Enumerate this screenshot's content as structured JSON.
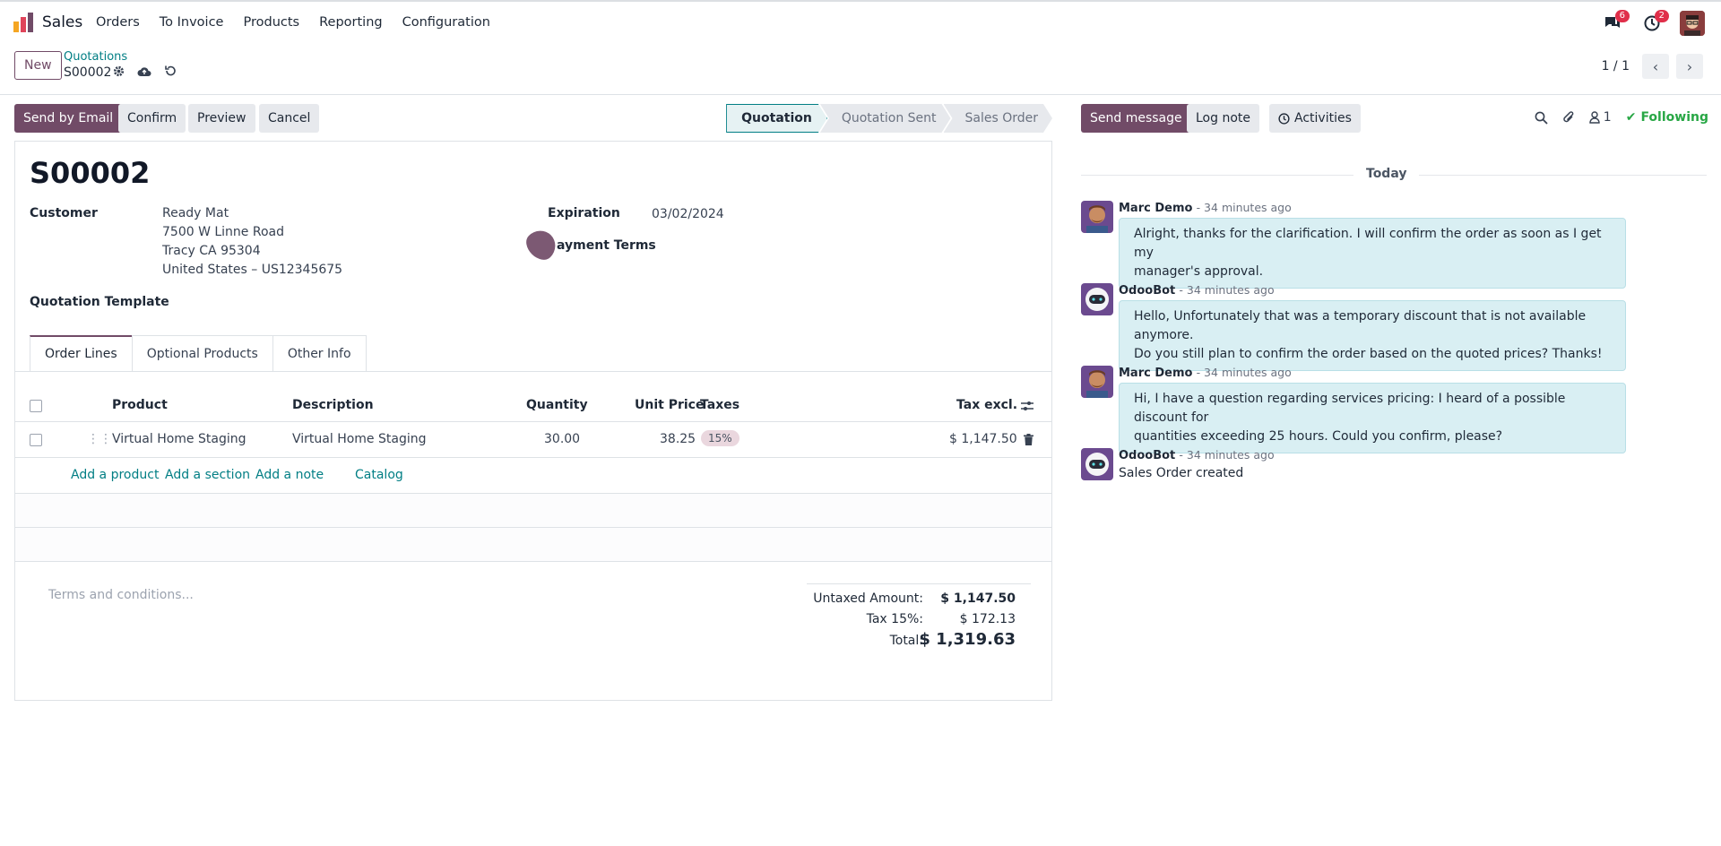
{
  "navbar": {
    "app_name": "Sales",
    "menu": [
      "Orders",
      "To Invoice",
      "Products",
      "Reporting",
      "Configuration"
    ],
    "messages_count": "6",
    "activities_count": "2"
  },
  "control_panel": {
    "new_label": "New",
    "breadcrumb_parent": "Quotations",
    "breadcrumb_current": "S00002",
    "pager": "1 / 1"
  },
  "statusbar": {
    "send_email": "Send by Email",
    "confirm": "Confirm",
    "preview": "Preview",
    "cancel": "Cancel",
    "stages": [
      "Quotation",
      "Quotation Sent",
      "Sales Order"
    ],
    "active_stage": "Quotation"
  },
  "form": {
    "title": "S00002",
    "customer_label": "Customer",
    "customer_lines": [
      "Ready Mat",
      "7500 W Linne Road",
      "Tracy CA 95304",
      "United States – US12345675"
    ],
    "expiration_label": "Expiration",
    "expiration_value": "03/02/2024",
    "payment_terms_label": "ayment Terms",
    "template_label": "Quotation Template",
    "tabs": [
      "Order Lines",
      "Optional Products",
      "Other Info"
    ],
    "columns": {
      "product": "Product",
      "description": "Description",
      "quantity": "Quantity",
      "unit_price": "Unit Price",
      "taxes": "Taxes",
      "tax_excl": "Tax excl."
    },
    "lines": [
      {
        "product": "Virtual Home Staging",
        "description": "Virtual Home Staging",
        "quantity": "30.00",
        "unit_price": "38.25",
        "tax": "15%",
        "subtotal": "$ 1,147.50"
      }
    ],
    "add_links": {
      "product": "Add a product",
      "section": "Add a section",
      "note": "Add a note",
      "catalog": "Catalog"
    },
    "terms_placeholder": "Terms and conditions...",
    "totals": {
      "untaxed_label": "Untaxed Amount:",
      "untaxed_value": "$ 1,147.50",
      "tax_label": "Tax 15%:",
      "tax_value": "$ 172.13",
      "total_label": "Total:",
      "total_value": "$ 1,319.63"
    }
  },
  "chatter": {
    "send_message": "Send message",
    "log_note": "Log note",
    "activities": "Activities",
    "followers_count": "1",
    "following": "Following",
    "date_separator": "Today",
    "messages": [
      {
        "author": "Marc Demo",
        "time": "- 34 minutes ago",
        "lines": [
          "Alright, thanks for the clarification. I will confirm the order as soon as I get my",
          "manager's approval."
        ]
      },
      {
        "author": "OdooBot",
        "time": "- 34 minutes ago",
        "lines": [
          "Hello, Unfortunately that was a temporary discount that is not available anymore.",
          "Do you still plan to confirm the order based on the quoted prices? Thanks!"
        ]
      },
      {
        "author": "Marc Demo",
        "time": "- 34 minutes ago",
        "lines": [
          "Hi, I have a question regarding services pricing: I heard of a possible discount for",
          "quantities exceeding 25 hours. Could you confirm, please?"
        ]
      },
      {
        "author": "OdooBot",
        "time": "- 34 minutes ago",
        "text": "Sales Order created"
      }
    ]
  },
  "colors": {
    "primary": "#714b67",
    "link": "#017e84",
    "bubble": "#d9eff3",
    "following": "#28a745"
  }
}
